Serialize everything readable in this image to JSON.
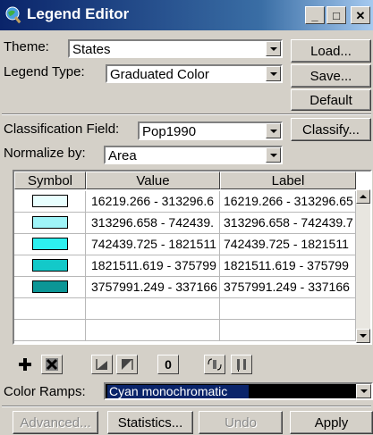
{
  "window": {
    "title": "Legend Editor",
    "controls": {
      "minimize": "_",
      "maximize": "□",
      "close": "✕"
    }
  },
  "theme": {
    "label": "Theme:",
    "value": "States"
  },
  "legend_type": {
    "label": "Legend Type:",
    "value": "Graduated Color"
  },
  "side_buttons": {
    "load": "Load...",
    "save": "Save...",
    "default": "Default"
  },
  "classification": {
    "field_label": "Classification Field:",
    "field_value": "Pop1990",
    "classify_label": "Classify...",
    "normalize_label": "Normalize by:",
    "normalize_value": "Area"
  },
  "table": {
    "headers": {
      "symbol": "Symbol",
      "value": "Value",
      "label": "Label"
    },
    "rows": [
      {
        "color": "#e8ffff",
        "value": "16219.266 - 313296.6",
        "label": "16219.266 - 313296.65"
      },
      {
        "color": "#9ff4f8",
        "value": "313296.658 - 742439.",
        "label": "313296.658 - 742439.7"
      },
      {
        "color": "#2df0f0",
        "value": "742439.725 - 1821511",
        "label": "742439.725 - 1821511"
      },
      {
        "color": "#13c9c9",
        "value": "1821511.619 - 375799",
        "label": "1821511.619 - 375799"
      },
      {
        "color": "#0c9696",
        "value": "3757991.249 - 337166",
        "label": "3757991.249 - 337166"
      }
    ]
  },
  "toolbar_icons": [
    "add-icon",
    "delete-icon",
    "flip-icon",
    "flip-reverse-icon",
    "null-value-icon",
    "calculate-icon",
    "sort-icon"
  ],
  "toolbar_null_text": "0",
  "color_ramps": {
    "label": "Color Ramps:",
    "value": "Cyan monochromatic"
  },
  "bottom_buttons": {
    "advanced": "Advanced...",
    "statistics": "Statistics...",
    "undo": "Undo",
    "apply": "Apply"
  }
}
